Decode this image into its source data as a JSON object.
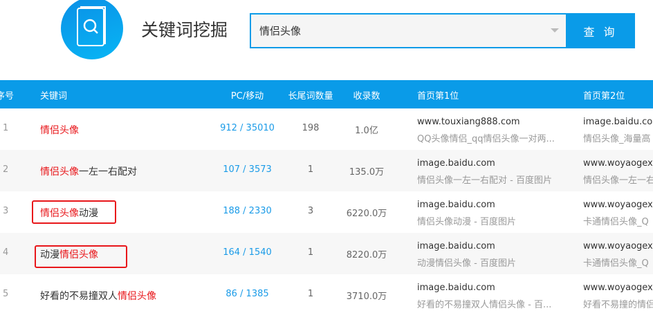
{
  "header": {
    "title": "关键词挖掘",
    "search_value": "情侣头像",
    "search_button": "查 询"
  },
  "table": {
    "columns": [
      "序号",
      "关键词",
      "PC/移动",
      "长尾词数量",
      "收录数",
      "首页第1位",
      "首页第2位"
    ],
    "rows": [
      {
        "index": "1",
        "kw_pre": "",
        "kw_hl": "情侣头像",
        "kw_post": "",
        "pc_mobile": "912 / 35010",
        "longtail": "198",
        "indexed": "1.0亿",
        "p1_domain": "www.touxiang888.com",
        "p1_title": "QQ头像情侣_qq情侣头像一对两...",
        "p2_domain": "image.baidu.com",
        "p2_title": "情侣头像_海量高"
      },
      {
        "index": "2",
        "kw_pre": "",
        "kw_hl": "情侣头像",
        "kw_post": "一左一右配对",
        "pc_mobile": "107 / 3573",
        "longtail": "1",
        "indexed": "135.0万",
        "p1_domain": "image.baidu.com",
        "p1_title": "情侣头像一左一右配对 - 百度图片",
        "p2_domain": "www.woyaogexi",
        "p2_title": "情侣头像一左一右"
      },
      {
        "index": "3",
        "kw_pre": "",
        "kw_hl": "情侣头像",
        "kw_post": "动漫",
        "pc_mobile": "188 / 2330",
        "longtail": "3",
        "indexed": "6220.0万",
        "p1_domain": "image.baidu.com",
        "p1_title": "情侣头像动漫 - 百度图片",
        "p2_domain": "www.woyaogexi",
        "p2_title": "卡通情侣头像_Q"
      },
      {
        "index": "4",
        "kw_pre": "动漫",
        "kw_hl": "情侣头像",
        "kw_post": "",
        "pc_mobile": "164 / 1540",
        "longtail": "1",
        "indexed": "8220.0万",
        "p1_domain": "image.baidu.com",
        "p1_title": "动漫情侣头像 - 百度图片",
        "p2_domain": "www.woyaogexi",
        "p2_title": "卡通情侣头像_Q"
      },
      {
        "index": "5",
        "kw_pre": "好看的不易撞双人",
        "kw_hl": "情侣头像",
        "kw_post": "",
        "pc_mobile": "86 / 1385",
        "longtail": "1",
        "indexed": "3710.0万",
        "p1_domain": "image.baidu.com",
        "p1_title": "好看的不易撞双人情侣头像 - 百...",
        "p2_domain": "www.woyaogexi",
        "p2_title": "好看不易撞的情侣"
      }
    ]
  },
  "colors": {
    "accent": "#0a9be8",
    "highlight": "#e8161a"
  }
}
